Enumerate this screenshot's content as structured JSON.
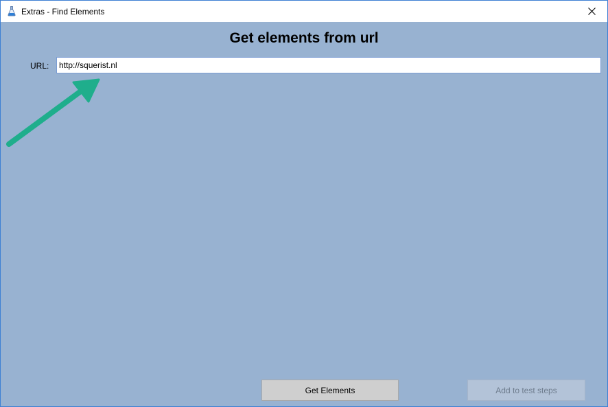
{
  "window": {
    "title": "Extras - Find Elements"
  },
  "main": {
    "heading": "Get elements from url",
    "url_label": "URL:",
    "url_value": "http://squerist.nl"
  },
  "buttons": {
    "get_elements": "Get Elements",
    "add_to_test_steps": "Add to test steps"
  },
  "colors": {
    "background": "#98b2d1",
    "annotation_arrow": "#1fae8c"
  },
  "icons": {
    "app": "flask-icon",
    "close": "close-icon",
    "annotation": "arrow-annotation"
  }
}
